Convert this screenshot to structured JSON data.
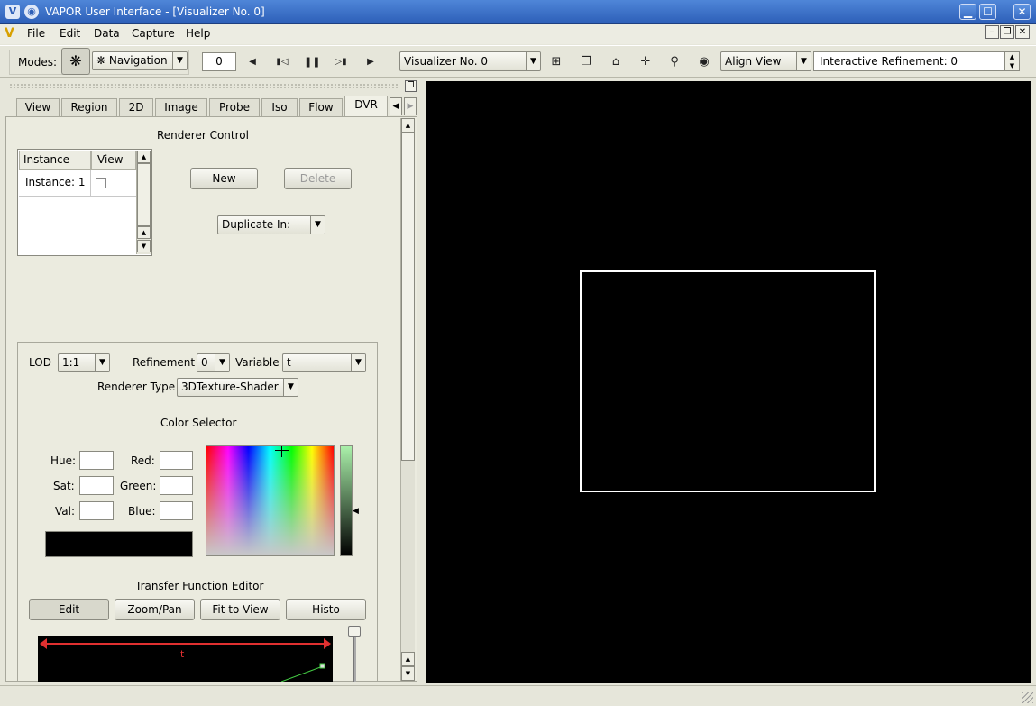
{
  "window": {
    "title": "VAPOR User Interface - [Visualizer No. 0]",
    "minimize": "▁",
    "maximize": "☐",
    "close": "✕"
  },
  "menu": [
    "File",
    "Edit",
    "Data",
    "Capture",
    "Help"
  ],
  "mdi_buttons": {
    "minimize": "–",
    "restore": "❐",
    "close": "✕"
  },
  "toolbar": {
    "modes_label": "Modes:",
    "mode_select": "Navigation",
    "frame_value": "0",
    "visualizer_select": "Visualizer No. 0",
    "align_view_select": "Align View",
    "refinement_value": "Interactive Refinement: 0"
  },
  "tabs": [
    "View",
    "Region",
    "2D",
    "Image",
    "Probe",
    "Iso",
    "Flow",
    "DVR"
  ],
  "active_tab": "DVR",
  "renderer_control": {
    "title": "Renderer Control",
    "table_headers": [
      "Instance",
      "View"
    ],
    "rows": [
      {
        "instance": "Instance: 1",
        "view": false
      }
    ],
    "new_button": "New",
    "delete_button": "Delete",
    "duplicate_select": "Duplicate In:"
  },
  "settings": {
    "lod_label": "LOD",
    "lod_value": "1:1",
    "refinement_label": "Refinement",
    "refinement_value": "0",
    "variable_label": "Variable",
    "variable_value": "t",
    "renderer_type_label": "Renderer Type",
    "renderer_type_value": "3DTexture-Shader"
  },
  "color_selector": {
    "title": "Color Selector",
    "hue_label": "Hue:",
    "sat_label": "Sat:",
    "val_label": "Val:",
    "red_label": "Red:",
    "green_label": "Green:",
    "blue_label": "Blue:",
    "hue": "",
    "sat": "",
    "val": "",
    "red": "",
    "green": "",
    "blue": "",
    "current_color": "#000000"
  },
  "transfer_function": {
    "title": "Transfer Function Editor",
    "edit_button": "Edit",
    "zoom_pan_button": "Zoom/Pan",
    "fit_to_view_button": "Fit to View",
    "histo_button": "Histo",
    "variable_label": "t",
    "domain_color": "#e03030"
  },
  "colors": {
    "viz_background": "#000000",
    "region_box": "#ffffff"
  }
}
